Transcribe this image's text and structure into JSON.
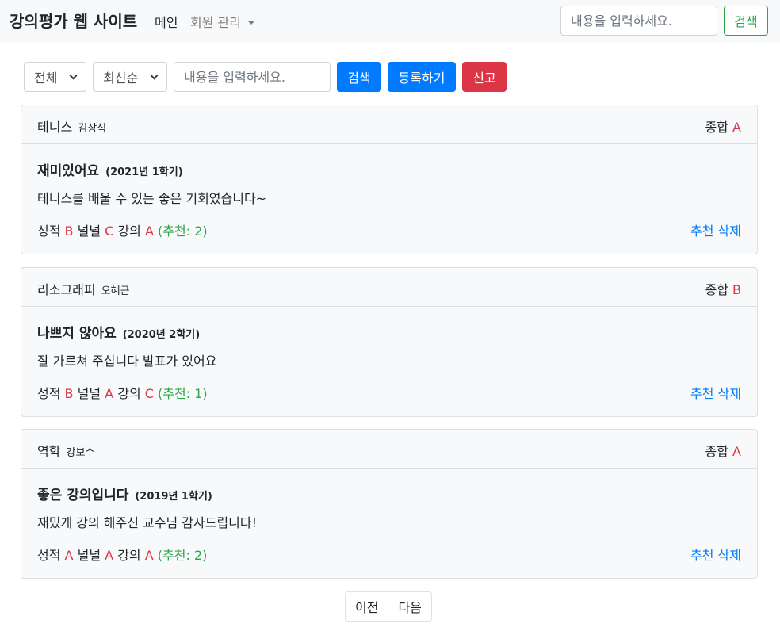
{
  "nav": {
    "brand": "강의평가 웹 사이트",
    "main": "메인",
    "member": "회원 관리",
    "search_placeholder": "내용을 입력하세요.",
    "search_label": "검색"
  },
  "filter": {
    "division": "전체",
    "sort": "최신순",
    "search_placeholder": "내용을 입력하세요.",
    "search_label": "검색",
    "register_label": "등록하기",
    "report_label": "신고"
  },
  "reviews": [
    {
      "lecture": "테니스",
      "professor": "김상식",
      "overall_label": "종합",
      "overall": "A",
      "title": "재미있어요",
      "semester": "(2021년 1학기)",
      "content": "테니스를 배울 수 있는 좋은 기회였습니다~",
      "credit_label": "성적",
      "credit": "B",
      "comfort_label": "널널",
      "comfort": "C",
      "lecture_label": "강의",
      "lecture_score": "A",
      "like_text": "(추천: 2)",
      "like_label": "추천",
      "delete_label": "삭제"
    },
    {
      "lecture": "리소그래피",
      "professor": "오혜근",
      "overall_label": "종합",
      "overall": "B",
      "title": "나쁘지 않아요",
      "semester": "(2020년 2학기)",
      "content": "잘 가르쳐 주십니다 발표가 있어요",
      "credit_label": "성적",
      "credit": "B",
      "comfort_label": "널널",
      "comfort": "A",
      "lecture_label": "강의",
      "lecture_score": "C",
      "like_text": "(추천: 1)",
      "like_label": "추천",
      "delete_label": "삭제"
    },
    {
      "lecture": "역학",
      "professor": "강보수",
      "overall_label": "종합",
      "overall": "A",
      "title": "좋은 강의입니다",
      "semester": "(2019년 1학기)",
      "content": "재밌게 강의 해주신 교수님 감사드립니다!",
      "credit_label": "성적",
      "credit": "A",
      "comfort_label": "널널",
      "comfort": "A",
      "lecture_label": "강의",
      "lecture_score": "A",
      "like_text": "(추천: 2)",
      "like_label": "추천",
      "delete_label": "삭제"
    }
  ],
  "pagination": {
    "prev": "이전",
    "next": "다음"
  },
  "colors": {
    "primary": "#007bff",
    "danger": "#dc3545",
    "success": "#28a745"
  }
}
